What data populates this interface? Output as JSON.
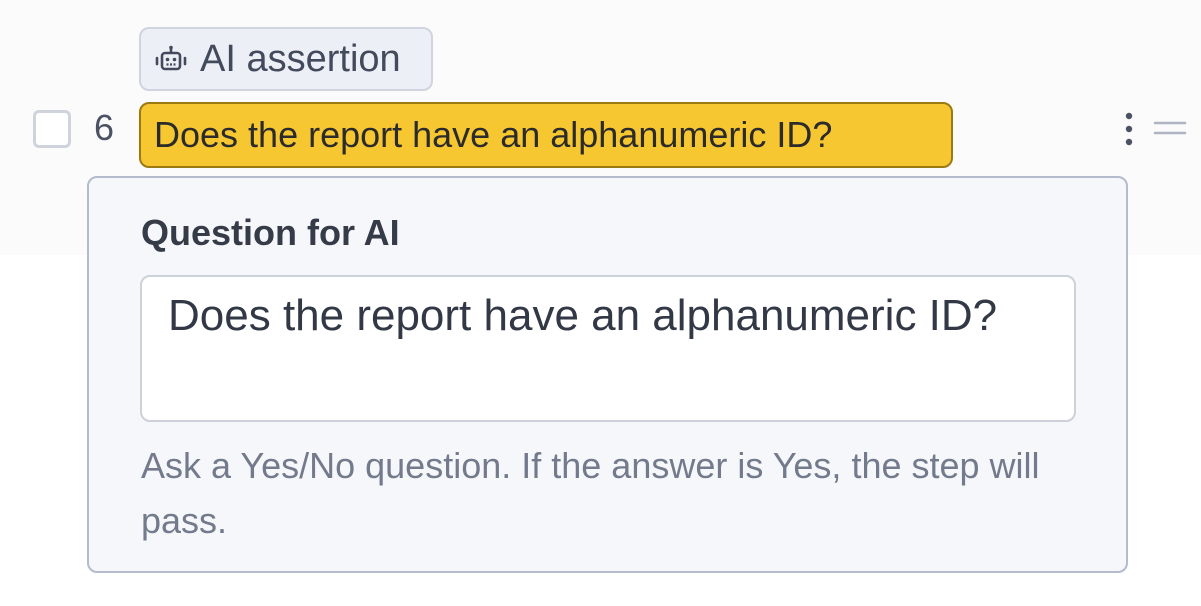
{
  "badge": {
    "label": "AI assertion",
    "icon": "robot-icon"
  },
  "step": {
    "number": "6",
    "text": "Does the report have an alphanumeric ID?",
    "checked": false,
    "chip_color": "#f7c731"
  },
  "panel": {
    "title": "Question for AI",
    "question_value": "Does the report have an alphanumeric ID?",
    "help_text": "Ask a Yes/No question. If the answer is Yes, the step will pass."
  },
  "actions": {
    "more_icon": "more-vertical-icon",
    "drag_icon": "drag-handle-icon"
  }
}
